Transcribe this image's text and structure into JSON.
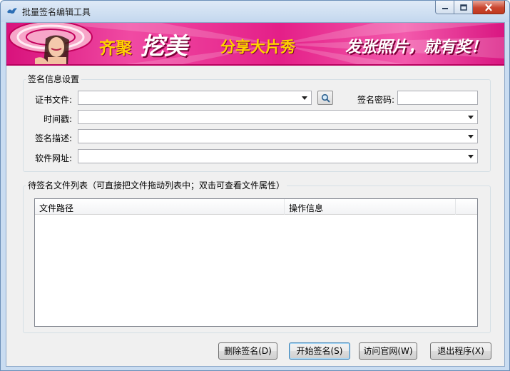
{
  "window": {
    "title": "批量签名编辑工具",
    "controls": {
      "minimize": "minimize",
      "maximize": "maximize",
      "close": "close"
    }
  },
  "banner": {
    "text1": "齐聚",
    "text2": "挖美",
    "text3": "分享大片秀",
    "text4": "发张照片，就有奖！"
  },
  "signature_settings": {
    "group_title": "签名信息设置",
    "cert_file_label": "证书文件:",
    "cert_file_value": "",
    "password_label": "签名密码:",
    "password_value": "",
    "timestamp_label": "时间戳:",
    "timestamp_value": "",
    "description_label": "签名描述:",
    "description_value": "",
    "software_url_label": "软件网址:",
    "software_url_value": ""
  },
  "file_list": {
    "group_title": "待签名文件列表（可直接把文件拖动列表中；双击可查看文件属性）",
    "columns": [
      "文件路径",
      "操作信息",
      ""
    ],
    "rows": []
  },
  "buttons": {
    "delete": "删除签名(D)",
    "start": "开始签名(S)",
    "visit": "访问官网(W)",
    "exit": "退出程序(X)"
  },
  "colors": {
    "banner_pink": "#e41f88",
    "banner_yellow": "#ffd200",
    "window_frame": "#c9dcf1",
    "client_bg": "#f0f0f0"
  },
  "icons": {
    "app": "app-bird-icon",
    "browse": "magnifier-icon"
  }
}
